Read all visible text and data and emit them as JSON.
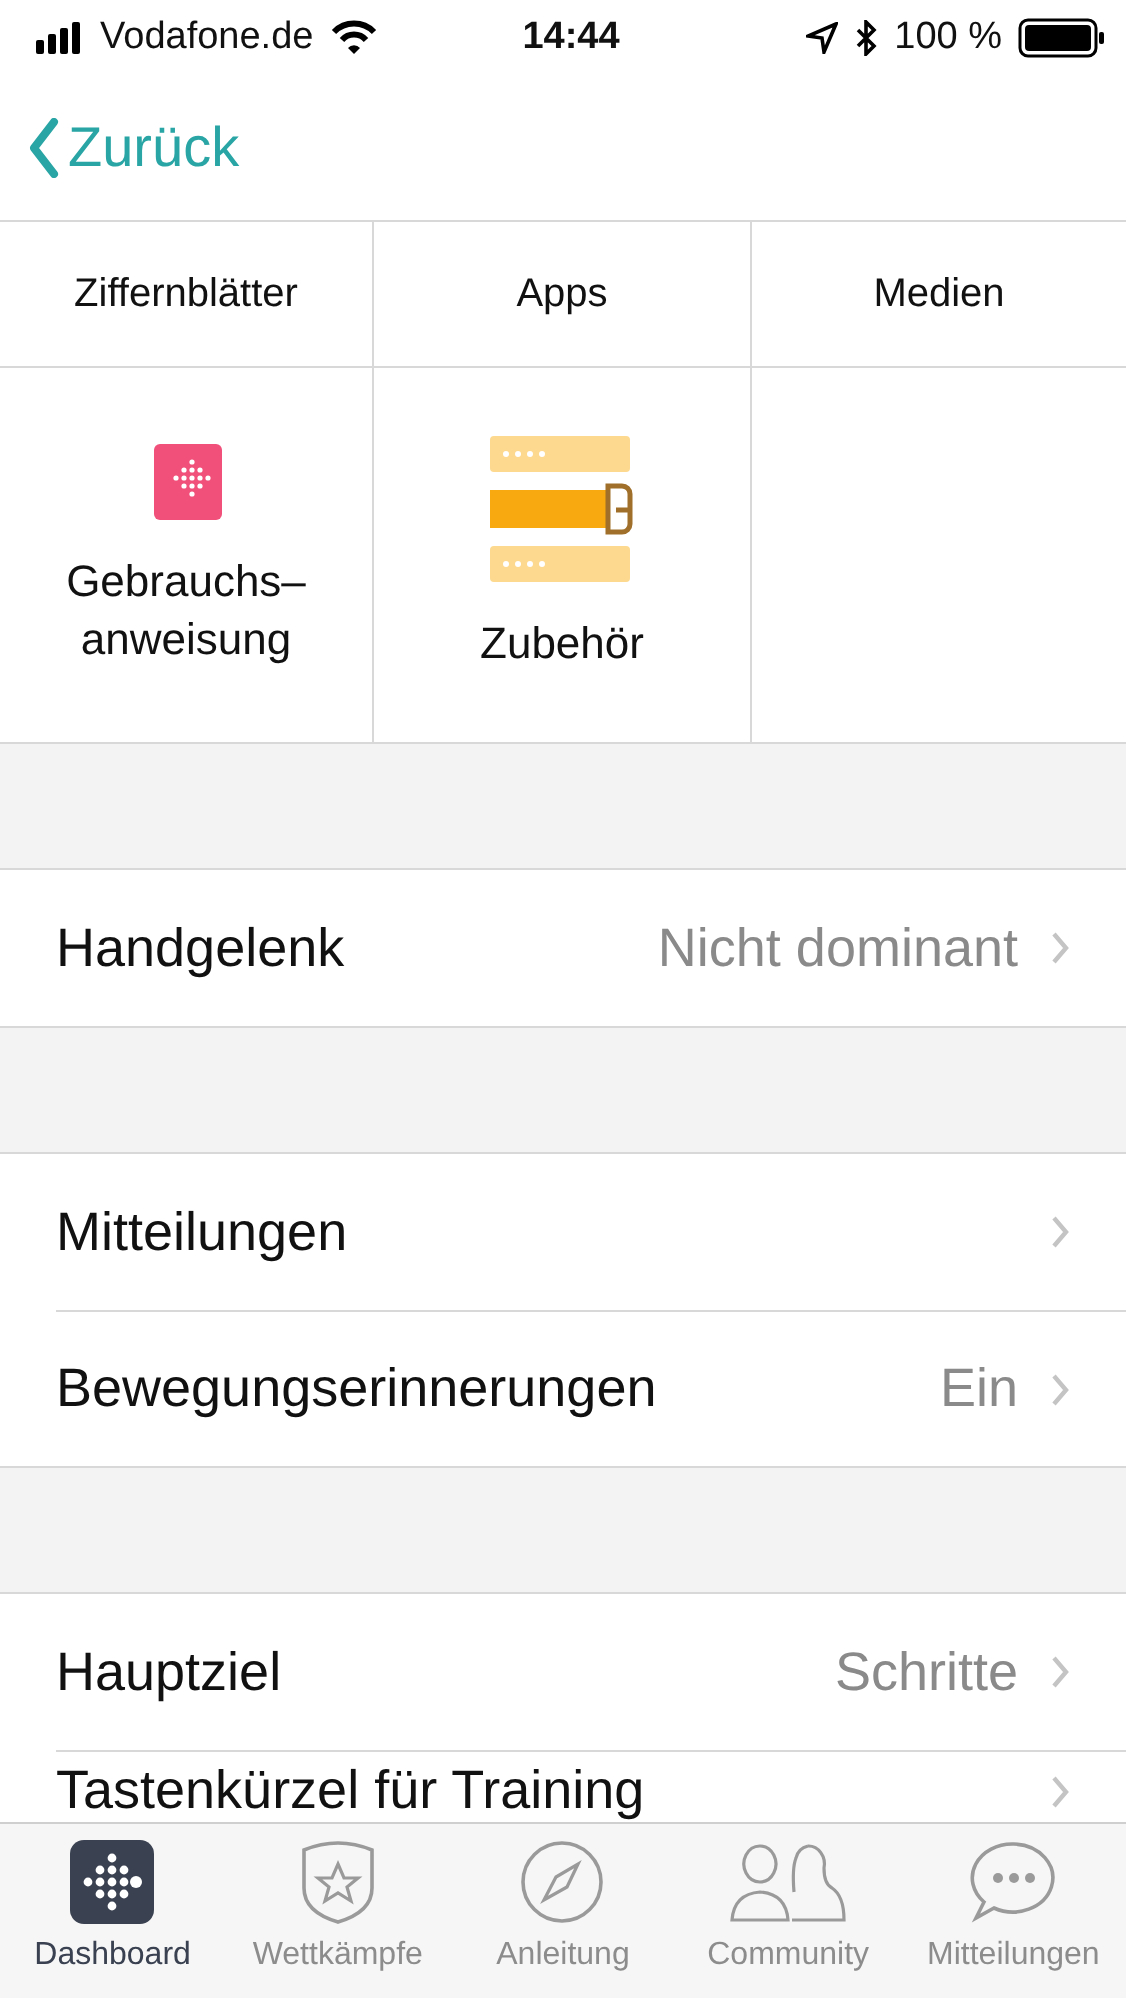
{
  "status_bar": {
    "carrier": "Vodafone.de",
    "time": "14:44",
    "battery": "100 %"
  },
  "nav": {
    "back": "Zurück"
  },
  "grid": [
    {
      "label": "Ziffernblätter",
      "kind": "text"
    },
    {
      "label": "Apps",
      "kind": "text"
    },
    {
      "label": "Medien",
      "kind": "text"
    },
    {
      "label": "Gebrauchs–\nanweisung",
      "kind": "manual"
    },
    {
      "label": "Zubehör",
      "kind": "accessory"
    }
  ],
  "sections": [
    [
      {
        "label": "Handgelenk",
        "value": "Nicht dominant"
      }
    ],
    [
      {
        "label": "Mitteilungen"
      },
      {
        "label": "Bewegungserinnerungen",
        "value": "Ein"
      }
    ],
    [
      {
        "label": "Hauptziel",
        "value": "Schritte"
      },
      {
        "label": "Tastenkürzel für Training"
      }
    ]
  ],
  "tabs": [
    {
      "label": "Dashboard",
      "kind": "dashboard",
      "selected": true
    },
    {
      "label": "Wettkämpfe",
      "kind": "challenges",
      "selected": false
    },
    {
      "label": "Anleitung",
      "kind": "guide",
      "selected": false
    },
    {
      "label": "Community",
      "kind": "community",
      "selected": false
    },
    {
      "label": "Mitteilungen",
      "kind": "messages",
      "selected": false
    }
  ]
}
